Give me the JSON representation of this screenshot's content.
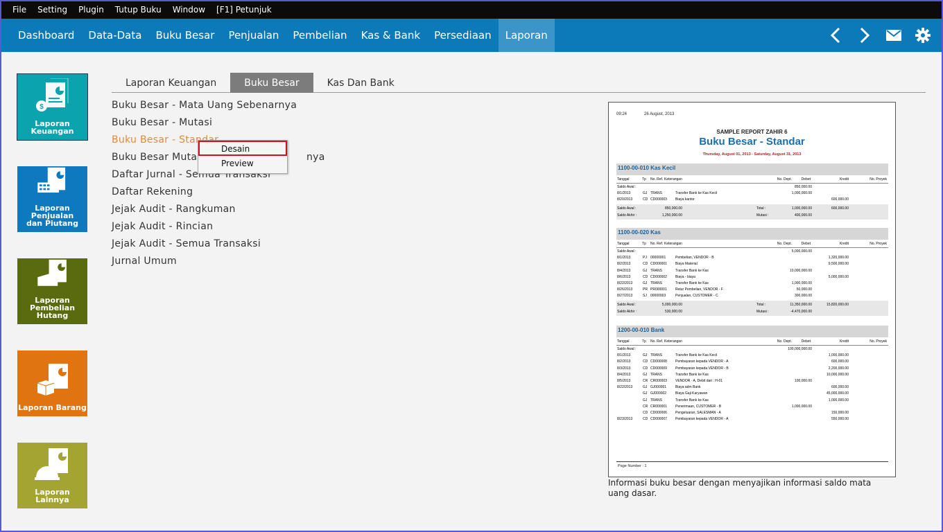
{
  "menubar": {
    "items": [
      "File",
      "Setting",
      "Plugin",
      "Tutup Buku",
      "Window",
      "[F1] Petunjuk"
    ]
  },
  "navbar": {
    "items": [
      "Dashboard",
      "Data-Data",
      "Buku Besar",
      "Penjualan",
      "Pembelian",
      "Kas & Bank",
      "Persediaan",
      "Laporan"
    ],
    "active": "Laporan"
  },
  "sidebar": {
    "tiles": [
      {
        "label1": "Laporan",
        "label2": "Keuangan",
        "color": "#0ba3ae",
        "icon": "financial-report-icon"
      },
      {
        "label1": "Laporan Penjualan",
        "label2": "dan Piutang",
        "color": "#0e79be",
        "icon": "sales-report-icon"
      },
      {
        "label1": "Laporan",
        "label2": "Pembelian Hutang",
        "color": "#5a6b0f",
        "icon": "purchase-report-icon"
      },
      {
        "label1": "Laporan Barang",
        "label2": "",
        "color": "#e07410",
        "icon": "inventory-report-icon"
      },
      {
        "label1": "Laporan Lainnya",
        "label2": "",
        "color": "#a3a432",
        "icon": "other-report-icon"
      }
    ]
  },
  "tabs": {
    "items": [
      "Laporan Keuangan",
      "Buku Besar",
      "Kas Dan Bank"
    ],
    "active": "Buku Besar"
  },
  "reports": {
    "items": [
      "Buku Besar - Mata Uang Sebenarnya",
      "Buku Besar - Mutasi",
      "Buku Besar - Standar",
      "Buku Besar Mutasi - ",
      "Daftar Jurnal - Semua Transaksi",
      "Daftar Rekening",
      "Jejak Audit - Rangkuman",
      "Jejak Audit - Rincian",
      "Jejak Audit - Semua Transaksi",
      "Jurnal Umum"
    ],
    "item4_tail": "nya",
    "selected": "Buku Besar - Standar"
  },
  "context_menu": {
    "items": [
      "Desain",
      "Preview"
    ],
    "highlighted": "Desain"
  },
  "preview": {
    "time": "09:24",
    "date": "26 August, 2013",
    "company": "SAMPLE REPORT ZAHIR 6",
    "title": "Buku Besar - Standar",
    "period": "Thursday, August 01, 2013 - Saturday, August 31, 2013",
    "columns": [
      "Tanggal",
      "Tp",
      "No. Ref.",
      "Keterangan",
      "No. Dept.",
      "Debet",
      "Kredit",
      "No. Proyek"
    ],
    "sum_labels": {
      "saldo_awal": "Saldo Awal :",
      "saldo_akhir": "Saldo Akhir :",
      "total": "Total :",
      "mutasi": "Mutasi :",
      "saldo_awal_row": "Saldo Awal :"
    },
    "page_number": "Page Number : 1",
    "accounts": [
      {
        "header": "1100-00-010  Kas Kecil",
        "opening": "850,000.00",
        "rows": [
          [
            "8/1/2013",
            "GJ",
            "TRANS",
            "Transfer Bank ke Kas Kecil",
            "",
            "1,000,000.00",
            ""
          ],
          [
            "8/20/2013",
            "CD",
            "CD000003",
            "Biaya kantor",
            "",
            "",
            "600,000.00"
          ]
        ],
        "saldo_awal": "850,000.00",
        "saldo_akhir": "1,250,000.00",
        "total_debet": "1,000,000.00",
        "total_kredit": "600,000.00",
        "mutasi": "400,000.00"
      },
      {
        "header": "1100-00-020  Kas",
        "opening": "5,000,000.00",
        "rows": [
          [
            "8/1/2013",
            "PJ",
            "00000001",
            "Pembelian, VENDOR - B",
            "",
            "",
            "1,320,000.00"
          ],
          [
            "8/2/2013",
            "CD",
            "CD000001",
            "Biaya Material",
            "",
            "",
            "9,500,000.00"
          ],
          [
            "8/4/2013",
            "GJ",
            "TRANS",
            "Transfer Bank ke Kas",
            "",
            "10,000,000.00",
            ""
          ],
          [
            "8/6/2013",
            "CD",
            "CD000002",
            "Biaya - biaya",
            "",
            "",
            "5,000,000.00"
          ],
          [
            "8/22/2013",
            "GJ",
            "TRANS",
            "Transfer Bank ke Kas",
            "",
            "1,000,000.00",
            ""
          ],
          [
            "8/26/2013",
            "PR",
            "PR000001",
            "Retur Pembelian, VENDOR - F",
            "",
            "50,000.00",
            ""
          ],
          [
            "8/27/2013",
            "SJ",
            "00000003",
            "Penjualan, CUSTOMER - C",
            "",
            "300,000.00",
            ""
          ]
        ],
        "saldo_awal": "5,000,000.00",
        "saldo_akhir": "530,000.00",
        "total_debet": "11,350,000.00",
        "total_kredit": "15,820,000.00",
        "mutasi": "-4,470,000.00"
      },
      {
        "header": "1200-00-010  Bank",
        "opening": "100,000,000.00",
        "rows": [
          [
            "8/1/2013",
            "GJ",
            "TRANS",
            "Transfer Bank ke Kas Kecil",
            "",
            "",
            "1,000,000.00"
          ],
          [
            "8/2/2013",
            "CD",
            "CD000008",
            "Pembayaran kepada VENDOR - A",
            "",
            "",
            "600,000.00"
          ],
          [
            "8/3/2013",
            "CD",
            "CD000009",
            "Pembayaran kepada VENDOR - B",
            "",
            "",
            "2,200,000.00"
          ],
          [
            "8/4/2013",
            "GJ",
            "TRANS",
            "Transfer Bank ke Kas",
            "",
            "",
            "10,000,000.00"
          ],
          [
            "8/5/2013",
            "CR",
            "CR000003",
            "VENDOR - A, Debit dari : H-01",
            "",
            "100,000.00",
            ""
          ],
          [
            "8/22/2013",
            "GJ",
            "GJ000001",
            "Biaya adm Bank",
            "",
            "",
            "600,000.00"
          ],
          [
            "",
            "GJ",
            "GJ000002",
            "Biaya Gaji Karyawan",
            "",
            "",
            "45,000,000.00"
          ],
          [
            "",
            "GJ",
            "TRANS",
            "Transfer Bank ke Kas",
            "",
            "",
            "1,000,000.00"
          ],
          [
            "",
            "CR",
            "CR000001",
            "Penerimaan, CUSTOMER - B",
            "",
            "1,000,000.00",
            ""
          ],
          [
            "",
            "CD",
            "CD000006",
            "Pengeluaran, SALESMAN - A",
            "",
            "",
            "150,000.00"
          ],
          [
            "8/23/2013",
            "CD",
            "CD000007",
            "Pembayaran kepada VENDOR - A",
            "",
            "",
            "550,000.00"
          ]
        ]
      }
    ]
  },
  "description": "Informasi buku besar dengan menyajikan informasi saldo mata uang dasar."
}
